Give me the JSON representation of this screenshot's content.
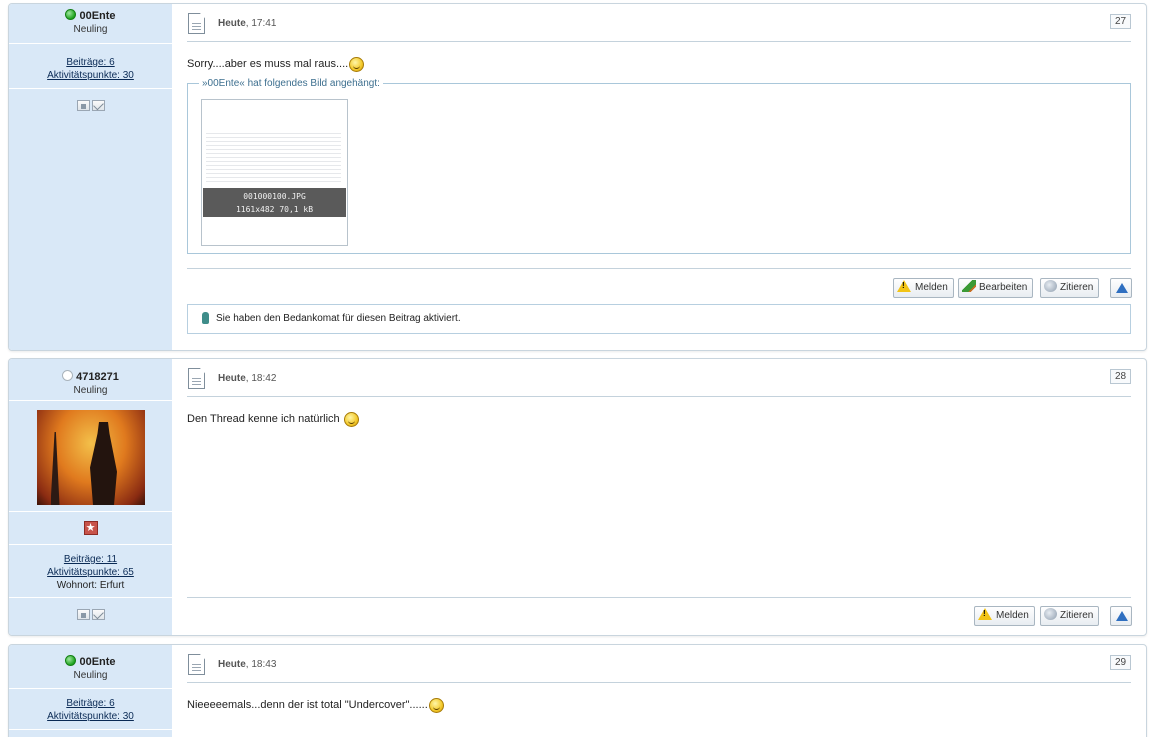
{
  "posts": [
    {
      "user": {
        "name": "00Ente",
        "rank": "Neuling",
        "online": true
      },
      "stats": {
        "posts": "Beiträge: 6",
        "points": "Aktivitätspunkte: 30"
      },
      "date_prefix": "Heute",
      "date_time": ", 17:41",
      "number": "27",
      "message": "Sorry....aber es muss mal raus....",
      "attachment": {
        "legend": "»00Ente« hat folgendes Bild angehängt:",
        "filename": "001000100.JPG",
        "meta": "1161x482 70,1 kB"
      },
      "buttons": {
        "report": "Melden",
        "edit": "Bearbeiten",
        "quote": "Zitieren"
      },
      "thanks_note": "Sie haben den Bedankomat für diesen Beitrag aktiviert."
    },
    {
      "user": {
        "name": "4718271",
        "rank": "Neuling",
        "online": false
      },
      "stats": {
        "posts": "Beiträge: 11",
        "points": "Aktivitätspunkte: 65",
        "location": "Wohnort: Erfurt"
      },
      "date_prefix": "Heute",
      "date_time": ", 18:42",
      "number": "28",
      "message": "Den Thread kenne ich natürlich",
      "buttons": {
        "report": "Melden",
        "quote": "Zitieren"
      }
    },
    {
      "user": {
        "name": "00Ente",
        "rank": "Neuling",
        "online": true
      },
      "stats": {
        "posts": "Beiträge: 6",
        "points": "Aktivitätspunkte: 30"
      },
      "date_prefix": "Heute",
      "date_time": ", 18:43",
      "number": "29",
      "message": "Nieeeeemals...denn der ist total \"Undercover\"......"
    }
  ],
  "colors": {
    "sidebar_bg": "#d9e8f7",
    "link": "#0a2a55",
    "legend": "#3d6f8f",
    "online": "#1ea31e"
  },
  "icons": {
    "post": "document-icon",
    "smiley": "smile-icon",
    "report": "warning-icon",
    "edit": "pencil-icon",
    "quote": "speech-bubble-icon",
    "top": "arrow-up-icon",
    "thanks": "thumbs-up-icon"
  }
}
